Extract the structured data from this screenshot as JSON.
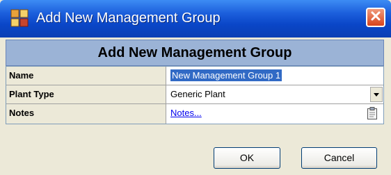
{
  "window": {
    "title": "Add New Management Group",
    "icon": "app-group-icon",
    "close_icon": "close-icon"
  },
  "form": {
    "header": "Add New Management Group",
    "fields": [
      {
        "label": "Name",
        "value": "New Management Group 1"
      },
      {
        "label": "Plant Type",
        "value": "Generic Plant"
      },
      {
        "label": "Notes",
        "value": "Notes..."
      }
    ]
  },
  "buttons": {
    "ok_label": "OK",
    "cancel_label": "Cancel"
  },
  "colors": {
    "titlebar": "#0a46c8",
    "header_band": "#9bb3d6",
    "selection": "#316ac5",
    "close": "#d8431c"
  }
}
